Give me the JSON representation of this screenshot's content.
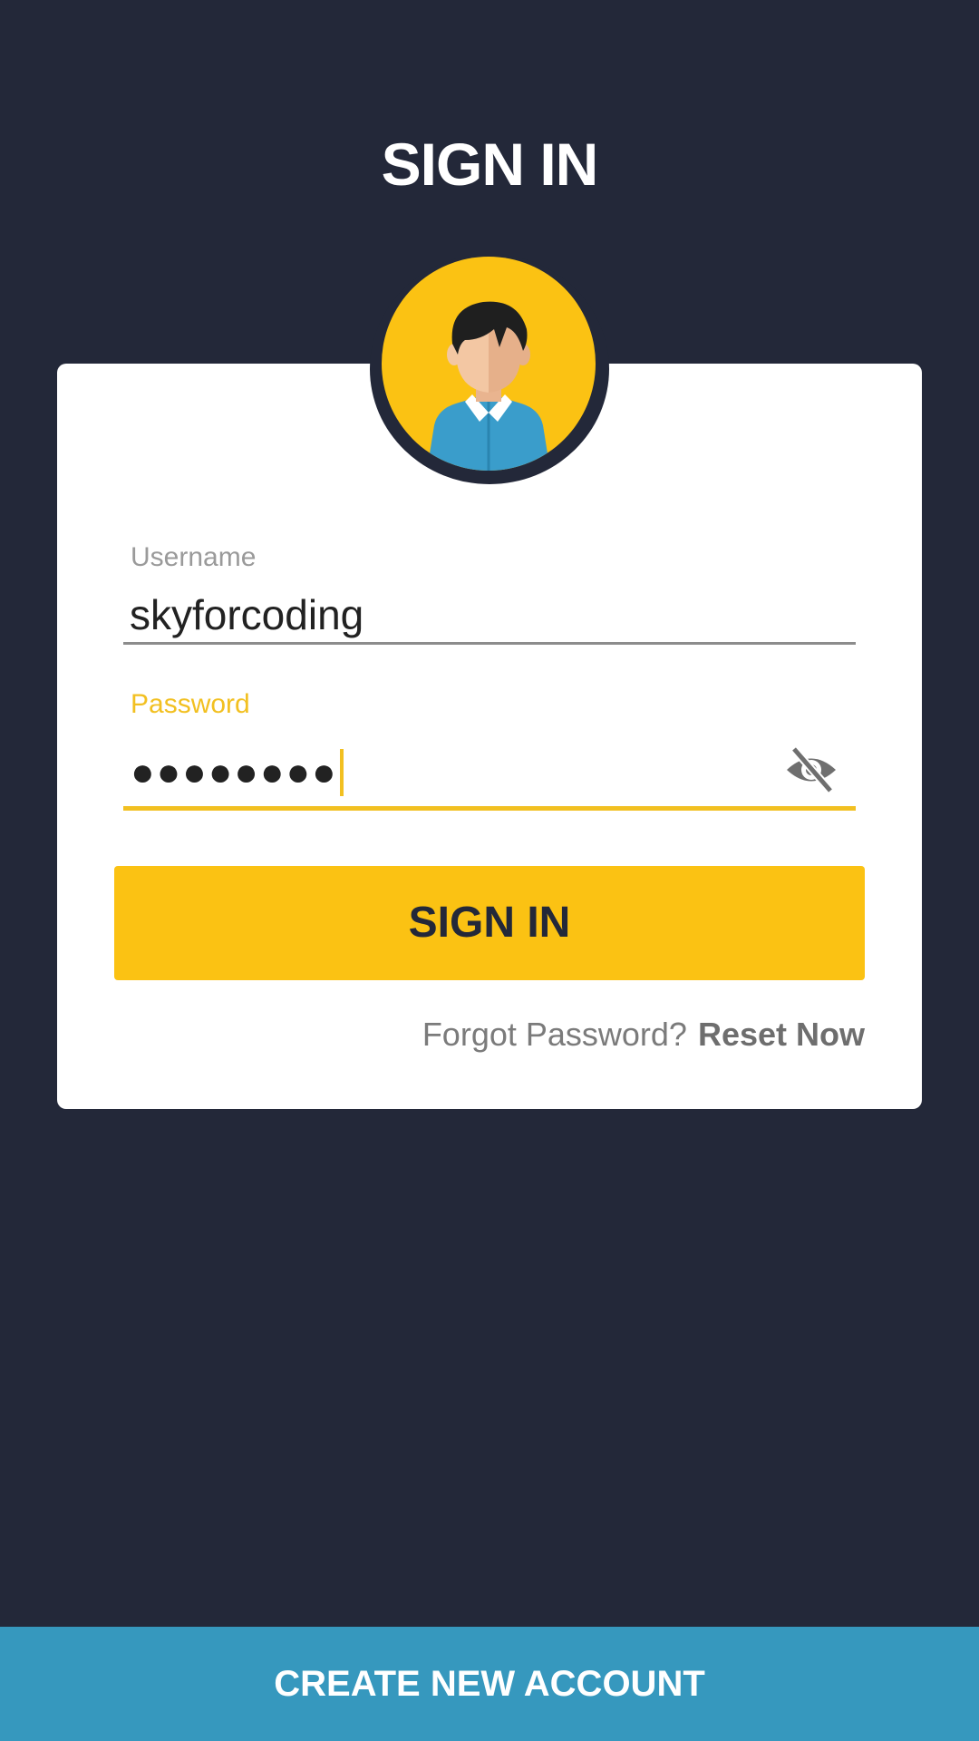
{
  "header": {
    "title": "SIGN IN"
  },
  "avatar": {
    "icon": "user-avatar-icon",
    "background_color": "#FBC213"
  },
  "form": {
    "username": {
      "label": "Username",
      "value": "skyforcoding"
    },
    "password": {
      "label": "Password",
      "masked_value": "●●●●●●●●",
      "toggle_icon": "eye-off-icon",
      "focused": true
    },
    "submit_label": "SIGN IN",
    "forgot_text": "Forgot Password?",
    "reset_link": "Reset Now"
  },
  "footer": {
    "create_account_label": "CREATE NEW ACCOUNT"
  },
  "colors": {
    "background": "#232839",
    "accent": "#FBC213",
    "secondary": "#3698BE",
    "card": "#ffffff"
  }
}
